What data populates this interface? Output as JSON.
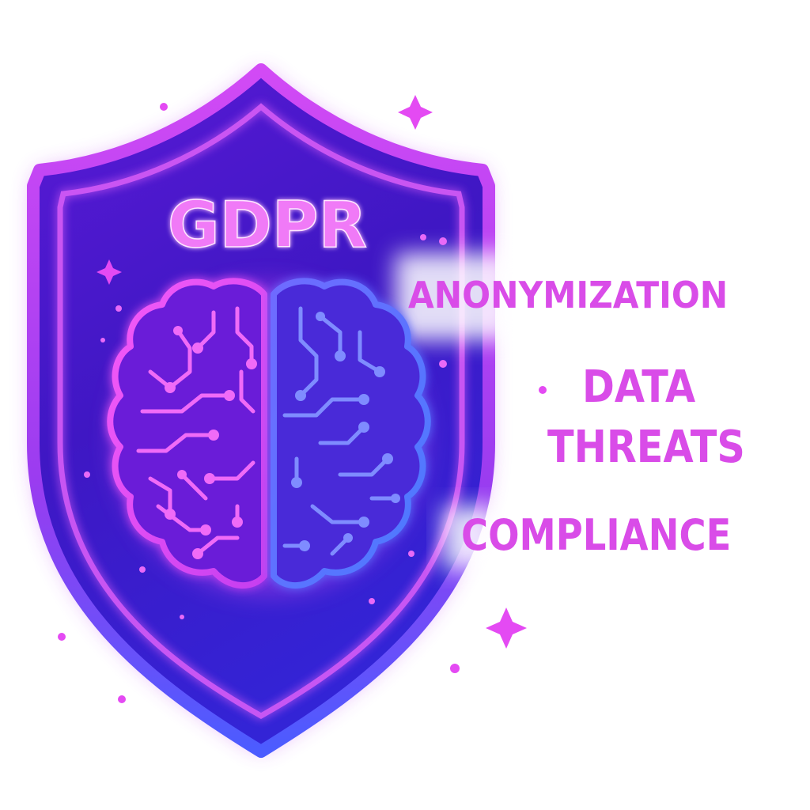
{
  "shield": {
    "title": "GDPR"
  },
  "keywords": [
    "ANONYMIZATION",
    "DATA",
    "THREATS",
    "COMPLIANCE"
  ],
  "colors": {
    "background": "#ffffff",
    "accent_magenta": "#e040f0",
    "shield_fill": "#4a1fd0",
    "shield_border": "#c43cf5",
    "glow_blue": "#4f6bff",
    "text": "#d94ce8"
  },
  "icons": {
    "emblem": "shield-icon",
    "brain": "brain-circuit-icon",
    "sparkle": "sparkle-icon"
  }
}
